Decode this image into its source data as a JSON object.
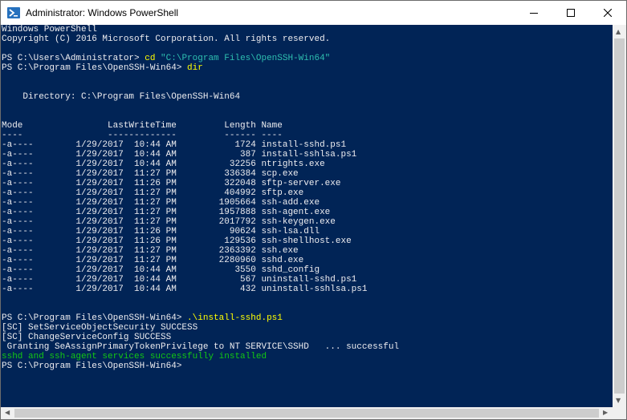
{
  "window": {
    "title": "Administrator: Windows PowerShell",
    "icon": "powershell-icon",
    "controls": [
      "minimize-icon",
      "maximize-icon",
      "close-icon"
    ]
  },
  "colors": {
    "background": "#012456",
    "text": "#eeedf0",
    "command": "#ffff00",
    "string": "#2ebfb0",
    "success": "#13c813"
  },
  "terminal": {
    "lines": [
      [
        {
          "t": "Windows PowerShell"
        }
      ],
      [
        {
          "t": "Copyright (C) 2016 Microsoft Corporation. All rights reserved."
        }
      ],
      [
        {
          "t": ""
        }
      ],
      [
        {
          "t": "PS C:\\Users\\Administrator> "
        },
        {
          "t": "cd ",
          "c": "kw"
        },
        {
          "t": "\"C:\\Program Files\\OpenSSH-Win64\"",
          "c": "str"
        }
      ],
      [
        {
          "t": "PS C:\\Program Files\\OpenSSH-Win64> "
        },
        {
          "t": "dir",
          "c": "kw"
        }
      ],
      [
        {
          "t": ""
        }
      ],
      [
        {
          "t": ""
        }
      ],
      [
        {
          "t": "    Directory: C:\\Program Files\\OpenSSH-Win64"
        }
      ],
      [
        {
          "t": ""
        }
      ],
      [
        {
          "t": ""
        }
      ],
      [
        {
          "t": "Mode                LastWriteTime         Length Name"
        }
      ],
      [
        {
          "t": "----                -------------         ------ ----"
        }
      ],
      [
        {
          "t": "-a----        1/29/2017  10:44 AM           1724 install-sshd.ps1"
        }
      ],
      [
        {
          "t": "-a----        1/29/2017  10:44 AM            387 install-sshlsa.ps1"
        }
      ],
      [
        {
          "t": "-a----        1/29/2017  10:44 AM          32256 ntrights.exe"
        }
      ],
      [
        {
          "t": "-a----        1/29/2017  11:27 PM         336384 scp.exe"
        }
      ],
      [
        {
          "t": "-a----        1/29/2017  11:26 PM         322048 sftp-server.exe"
        }
      ],
      [
        {
          "t": "-a----        1/29/2017  11:27 PM         404992 sftp.exe"
        }
      ],
      [
        {
          "t": "-a----        1/29/2017  11:27 PM        1905664 ssh-add.exe"
        }
      ],
      [
        {
          "t": "-a----        1/29/2017  11:27 PM        1957888 ssh-agent.exe"
        }
      ],
      [
        {
          "t": "-a----        1/29/2017  11:27 PM        2017792 ssh-keygen.exe"
        }
      ],
      [
        {
          "t": "-a----        1/29/2017  11:26 PM          90624 ssh-lsa.dll"
        }
      ],
      [
        {
          "t": "-a----        1/29/2017  11:26 PM         129536 ssh-shellhost.exe"
        }
      ],
      [
        {
          "t": "-a----        1/29/2017  11:27 PM        2363392 ssh.exe"
        }
      ],
      [
        {
          "t": "-a----        1/29/2017  11:27 PM        2280960 sshd.exe"
        }
      ],
      [
        {
          "t": "-a----        1/29/2017  10:44 AM           3550 sshd_config"
        }
      ],
      [
        {
          "t": "-a----        1/29/2017  10:44 AM            567 uninstall-sshd.ps1"
        }
      ],
      [
        {
          "t": "-a----        1/29/2017  10:44 AM            432 uninstall-sshlsa.ps1"
        }
      ],
      [
        {
          "t": ""
        }
      ],
      [
        {
          "t": ""
        }
      ],
      [
        {
          "t": "PS C:\\Program Files\\OpenSSH-Win64> "
        },
        {
          "t": ".\\install-sshd.ps1",
          "c": "kw"
        }
      ],
      [
        {
          "t": "[SC] SetServiceObjectSecurity SUCCESS"
        }
      ],
      [
        {
          "t": "[SC] ChangeServiceConfig SUCCESS"
        }
      ],
      [
        {
          "t": " Granting SeAssignPrimaryTokenPrivilege to NT SERVICE\\SSHD   ... successful"
        }
      ],
      [
        {
          "t": "sshd and ssh-agent services successfully installed",
          "c": "ok"
        }
      ],
      [
        {
          "t": "PS C:\\Program Files\\OpenSSH-Win64>"
        }
      ]
    ]
  }
}
